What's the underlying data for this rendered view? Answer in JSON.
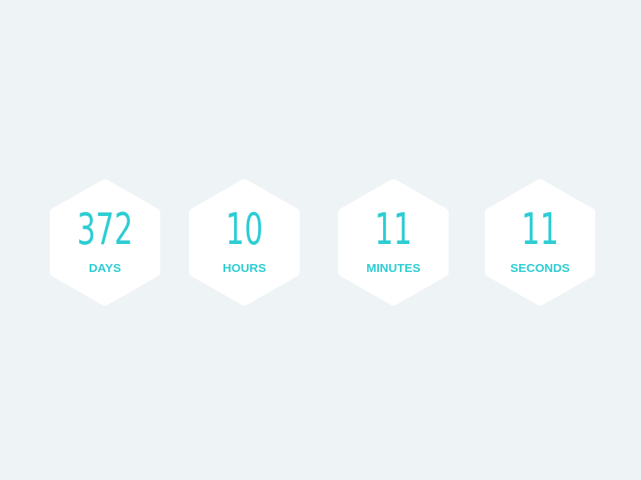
{
  "colors": {
    "background": "#eef3f6",
    "card": "#ffffff",
    "accent": "#2dcdd3"
  },
  "countdown": {
    "units": [
      {
        "value": "372",
        "label": "DAYS"
      },
      {
        "value": "10",
        "label": "HOURS"
      },
      {
        "value": "11",
        "label": "MINUTES"
      },
      {
        "value": "11",
        "label": "SECONDS"
      }
    ]
  }
}
